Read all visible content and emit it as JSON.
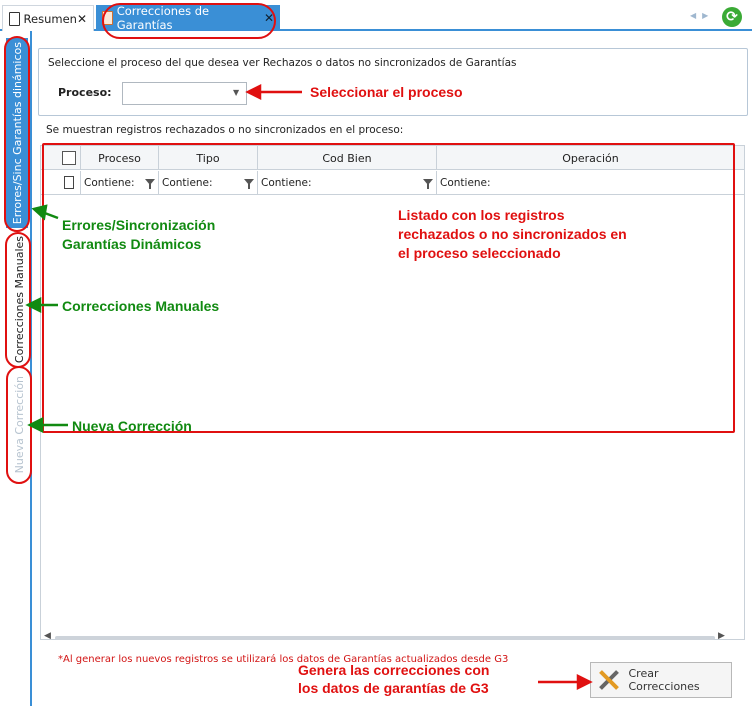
{
  "tabs": [
    {
      "label": "Resumen",
      "close": "✕"
    },
    {
      "label": "Correcciones de Garantías",
      "close": "✕"
    }
  ],
  "vertical_tabs": [
    {
      "label": "Errores/Sinc Garantías dinámicos"
    },
    {
      "label": "Correcciones Manuales"
    },
    {
      "label": "Nueva Corrección"
    }
  ],
  "panel": {
    "instruction": "Seleccione el proceso del que desea ver Rechazos o datos no sincronizados de Garantías",
    "process_label": "Proceso:",
    "process_value": "",
    "info": "Se muestran registros rechazados o no sincronizados en el proceso:"
  },
  "grid": {
    "columns": [
      "Proceso",
      "Tipo",
      "Cod Bien",
      "Operación"
    ],
    "filter_text": "Contiene:"
  },
  "note": "*Al generar los nuevos registros se utilizará los datos de Garantías actualizados desde G3",
  "button": {
    "label": "Crear Correcciones"
  },
  "annotations": {
    "select_process": "Seleccionar el proceso",
    "list_desc_1": "Listado con los registros",
    "list_desc_2": "rechazados o no sincronizados en",
    "list_desc_3": "el proceso seleccionado",
    "errors_1": "Errores/Sincronización",
    "errors_2": "Garantías Dinámicos",
    "manual": "Correcciones Manuales",
    "new": "Nueva Corrección",
    "gen_1": "Genera las correcciones con",
    "gen_2": "los datos de garantías de G3"
  },
  "colors": {
    "accent": "#3a8fd6",
    "annotation_red": "#e01010",
    "annotation_green": "#118a11"
  }
}
